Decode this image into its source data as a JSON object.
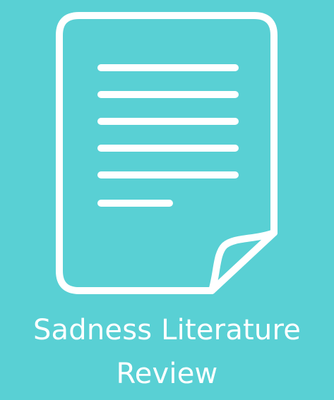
{
  "colors": {
    "background": "#59d0d4",
    "foreground": "#ffffff"
  },
  "icon": {
    "name": "document-icon",
    "text_lines": 6
  },
  "caption": {
    "line1": "Sadness Literature",
    "line2": "Review"
  }
}
